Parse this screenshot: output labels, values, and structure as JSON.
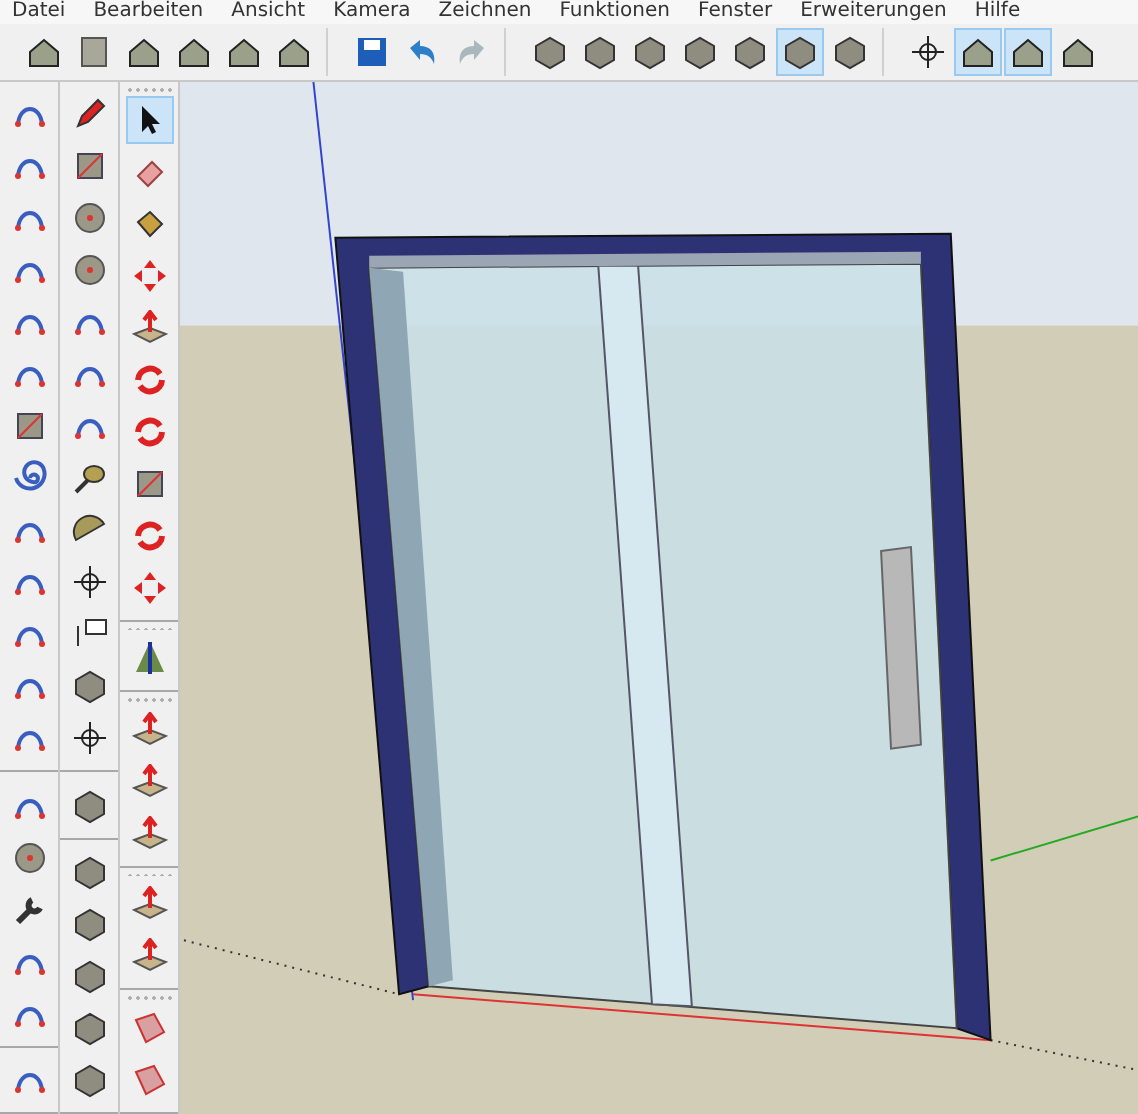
{
  "menu": [
    "Datei",
    "Bearbeiten",
    "Ansicht",
    "Kamera",
    "Zeichnen",
    "Funktionen",
    "Fenster",
    "Erweiterungen",
    "Hilfe"
  ],
  "toolbar_groups": [
    {
      "tools": [
        {
          "selected": false
        },
        {
          "selected": false
        },
        {
          "selected": false
        },
        {
          "selected": false
        },
        {
          "selected": false
        },
        {
          "selected": false
        }
      ]
    },
    {
      "tools": [
        {
          "selected": false
        },
        {
          "selected": false
        },
        {
          "selected": false
        }
      ]
    },
    {
      "tools": [
        {
          "selected": false
        },
        {
          "selected": false
        },
        {
          "selected": false
        },
        {
          "selected": false
        },
        {
          "selected": false
        },
        {
          "selected": true
        },
        {
          "selected": false
        }
      ]
    },
    {
      "tools": [
        {
          "selected": false
        },
        {
          "selected": true
        },
        {
          "selected": true
        },
        {
          "selected": false
        }
      ]
    }
  ],
  "side_columns": [
    {
      "groups": [
        {
          "tools": [
            {
              "selected": false
            },
            {
              "selected": false
            },
            {
              "selected": false
            },
            {
              "selected": false
            },
            {
              "selected": false
            },
            {
              "selected": false
            },
            {
              "selected": false
            },
            {
              "selected": false
            },
            {
              "selected": false
            },
            {
              "selected": false
            },
            {
              "selected": false
            },
            {
              "selected": false
            },
            {
              "selected": false
            }
          ]
        },
        {
          "tools": [
            {
              "selected": false
            },
            {
              "selected": false
            },
            {
              "selected": false
            },
            {
              "selected": false
            },
            {
              "selected": false
            }
          ]
        },
        {
          "tools": [
            {
              "selected": false
            }
          ]
        }
      ]
    },
    {
      "groups": [
        {
          "tools": [
            {
              "selected": false
            },
            {
              "selected": false
            },
            {
              "selected": false
            },
            {
              "selected": false
            },
            {
              "selected": false
            },
            {
              "selected": false
            },
            {
              "selected": false
            },
            {
              "selected": false
            },
            {
              "selected": false
            },
            {
              "selected": false
            },
            {
              "selected": false
            },
            {
              "selected": false
            },
            {
              "selected": false
            }
          ]
        },
        {
          "tools": [
            {
              "selected": false
            }
          ]
        },
        {
          "tools": [
            {
              "selected": false
            },
            {
              "selected": false
            },
            {
              "selected": false
            },
            {
              "selected": false
            },
            {
              "selected": false
            }
          ]
        }
      ]
    },
    {
      "groups": [
        {
          "tools": [
            {
              "selected": true
            },
            {
              "selected": false
            },
            {
              "selected": false
            },
            {
              "selected": false
            },
            {
              "selected": false
            },
            {
              "selected": false
            },
            {
              "selected": false
            },
            {
              "selected": false
            },
            {
              "selected": false
            },
            {
              "selected": false
            }
          ]
        },
        {
          "tools": [
            {
              "selected": false
            }
          ]
        },
        {
          "tools": [
            {
              "selected": false
            },
            {
              "selected": false
            },
            {
              "selected": false
            }
          ]
        },
        {
          "tools": [
            {
              "selected": false
            },
            {
              "selected": false
            }
          ]
        },
        {
          "tools": [
            {
              "selected": false
            },
            {
              "selected": false
            }
          ]
        }
      ]
    }
  ]
}
